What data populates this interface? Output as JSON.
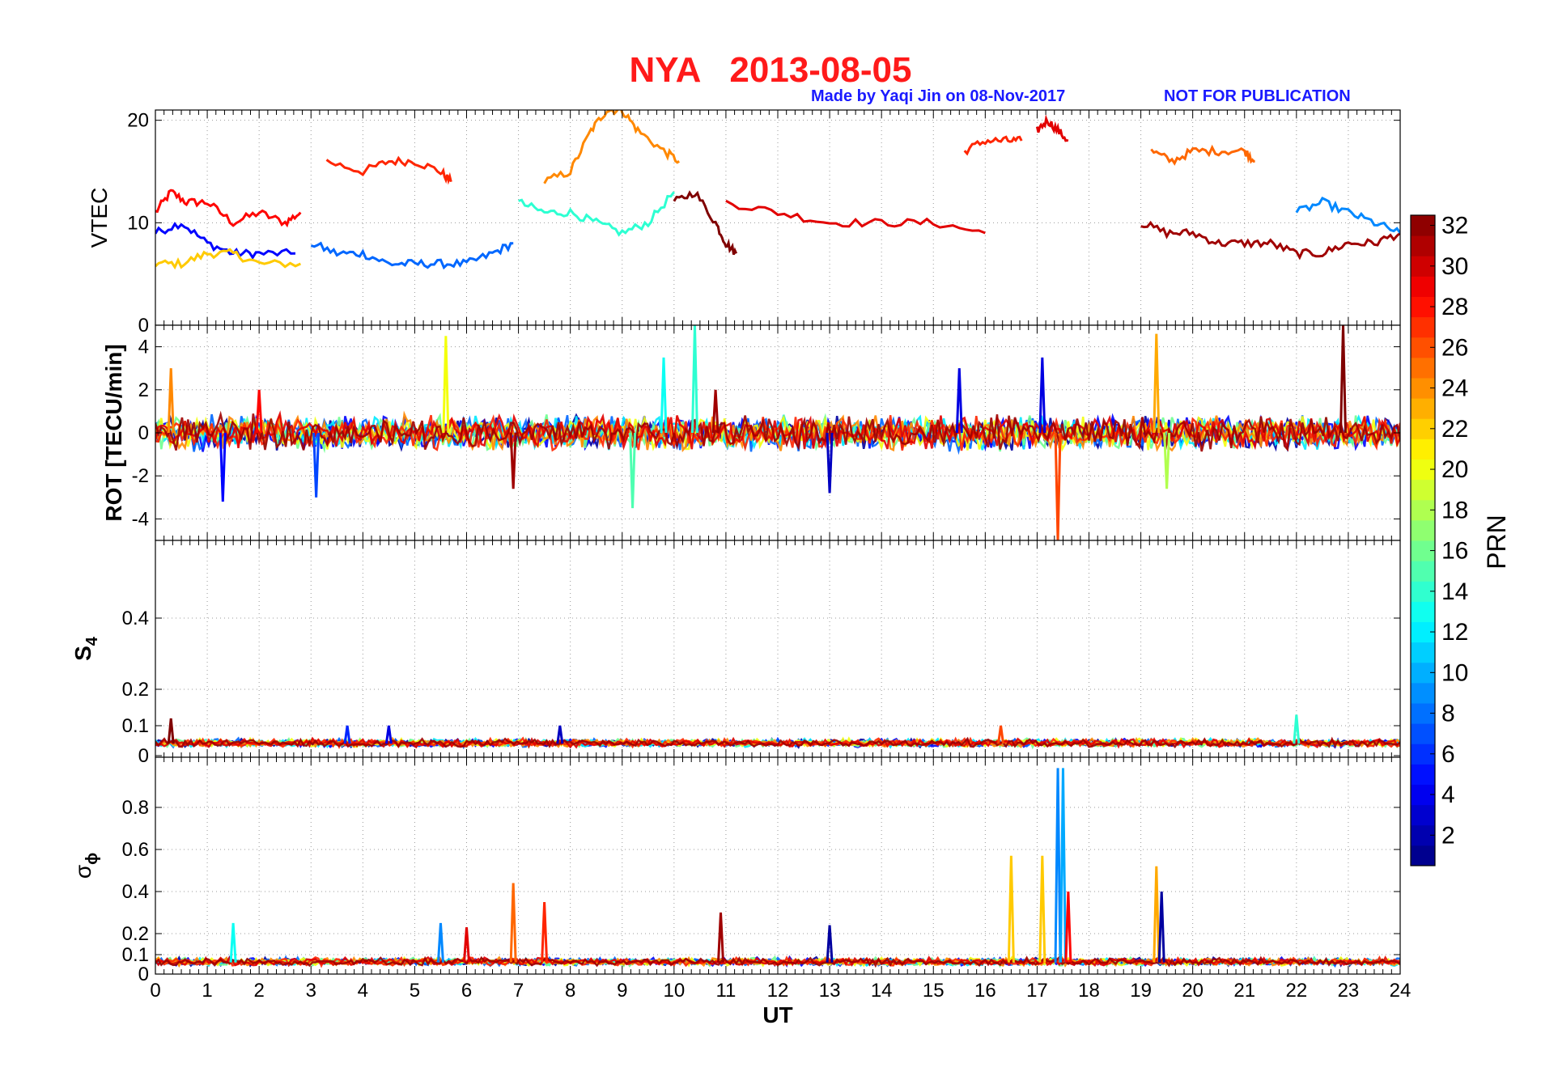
{
  "header": {
    "title": "NYA   2013-08-05",
    "credit": "Made by Yaqi Jin on 08-Nov-2017",
    "notice": "NOT FOR PUBLICATION"
  },
  "colors": {
    "title": "#ff1a1a",
    "credit": "#1a1aff",
    "axes": "#000000",
    "grid": "#9a9a9a"
  },
  "chart_data": [
    {
      "type": "line",
      "panel": "VTEC",
      "ylabel": "VTEC",
      "ylim": [
        0,
        21
      ],
      "yticks": [
        "0",
        "10",
        "20"
      ],
      "ytick_values": [
        0,
        10,
        20
      ],
      "xlim": [
        0,
        24
      ],
      "grid": true,
      "note_series": "multi-colored series, one per satellite PRN (1–32)",
      "series_approx": [
        {
          "prn": 28,
          "x": [
            0.0,
            0.3,
            0.6,
            1.0,
            1.5,
            2.0,
            2.5,
            2.8
          ],
          "y": [
            11,
            13,
            12,
            12,
            10,
            11,
            10,
            11
          ]
        },
        {
          "prn": 5,
          "x": [
            0.0,
            0.5,
            1.0,
            1.5,
            2.0,
            2.7
          ],
          "y": [
            9,
            10,
            8,
            7,
            7,
            7
          ]
        },
        {
          "prn": 22,
          "x": [
            0.0,
            0.5,
            1.0,
            1.5,
            2.0,
            2.8
          ],
          "y": [
            6,
            6,
            7,
            7,
            6,
            6
          ]
        },
        {
          "prn": 27,
          "x": [
            3.3,
            4.0,
            4.5,
            5.0,
            5.5,
            5.7
          ],
          "y": [
            16,
            15,
            16,
            16,
            15,
            14
          ]
        },
        {
          "prn": 8,
          "x": [
            3.0,
            3.5,
            4.0,
            4.5,
            5.0,
            5.5,
            6.0,
            6.5,
            6.9
          ],
          "y": [
            8,
            7,
            7,
            6,
            6,
            6,
            6,
            7,
            8
          ]
        },
        {
          "prn": 24,
          "x": [
            7.5,
            8.0,
            8.4,
            8.7,
            9.0,
            9.3,
            9.8,
            10.1
          ],
          "y": [
            14,
            15,
            19,
            21,
            21,
            19,
            17,
            16
          ]
        },
        {
          "prn": 14,
          "x": [
            7.0,
            7.5,
            8.0,
            8.5,
            9.0,
            9.5,
            10.0
          ],
          "y": [
            12,
            11,
            11,
            10,
            9,
            10,
            13
          ]
        },
        {
          "prn": 32,
          "x": [
            10.0,
            10.4,
            10.8,
            11.0,
            11.2
          ],
          "y": [
            12,
            13,
            10,
            8,
            7
          ]
        },
        {
          "prn": 29,
          "x": [
            11.0,
            12.0,
            13.0,
            14.0,
            15.0,
            16.0
          ],
          "y": [
            12,
            11,
            10,
            10,
            10,
            9
          ]
        },
        {
          "prn": 27,
          "x": [
            15.6,
            16.0,
            16.4,
            16.7
          ],
          "y": [
            17,
            18,
            18,
            18
          ]
        },
        {
          "prn": 29,
          "x": [
            17.0,
            17.2,
            17.4,
            17.6
          ],
          "y": [
            19,
            20,
            19,
            18
          ]
        },
        {
          "prn": 25,
          "x": [
            19.2,
            19.6,
            20.0,
            20.5,
            21.0,
            21.2
          ],
          "y": [
            17,
            16,
            17,
            17,
            17,
            16
          ]
        },
        {
          "prn": 31,
          "x": [
            19.0,
            19.5,
            20.0,
            20.5,
            21.0,
            21.5,
            22.0,
            22.5,
            23.0,
            23.5,
            24.0
          ],
          "y": [
            10,
            9,
            9,
            8,
            8,
            8,
            7,
            7,
            8,
            8,
            9
          ]
        },
        {
          "prn": 9,
          "x": [
            22.0,
            22.5,
            23.0,
            23.5,
            24.0
          ],
          "y": [
            11,
            12,
            11,
            10,
            9
          ]
        }
      ]
    },
    {
      "type": "line",
      "panel": "ROT",
      "ylabel": "ROT [TECU/min]",
      "ylim": [
        -5,
        5
      ],
      "yticks": [
        "-4",
        "-2",
        "0",
        "2",
        "4"
      ],
      "ytick_values": [
        -4,
        -2,
        0,
        2,
        4
      ],
      "xlim": [
        0,
        24
      ],
      "grid": true,
      "baseline": 0,
      "noise_amplitude": 0.6,
      "spikes": [
        {
          "x": 0.3,
          "y": 3.0,
          "prn": 24
        },
        {
          "x": 1.3,
          "y": -3.2,
          "prn": 5
        },
        {
          "x": 2.0,
          "y": 2.0,
          "prn": 28
        },
        {
          "x": 3.1,
          "y": -3.0,
          "prn": 7
        },
        {
          "x": 5.6,
          "y": 4.5,
          "prn": 20
        },
        {
          "x": 6.9,
          "y": -2.6,
          "prn": 31
        },
        {
          "x": 9.2,
          "y": -3.5,
          "prn": 15
        },
        {
          "x": 9.8,
          "y": 3.5,
          "prn": 13
        },
        {
          "x": 10.4,
          "y": 5.0,
          "prn": 14
        },
        {
          "x": 10.8,
          "y": 2.0,
          "prn": 31
        },
        {
          "x": 13.0,
          "y": -2.8,
          "prn": 3
        },
        {
          "x": 15.5,
          "y": 3.0,
          "prn": 4
        },
        {
          "x": 17.4,
          "y": -5.0,
          "prn": 26
        },
        {
          "x": 17.1,
          "y": 3.5,
          "prn": 4
        },
        {
          "x": 19.3,
          "y": 4.6,
          "prn": 23
        },
        {
          "x": 19.5,
          "y": -2.6,
          "prn": 18
        },
        {
          "x": 22.9,
          "y": 5.0,
          "prn": 32
        }
      ]
    },
    {
      "type": "line",
      "panel": "S4",
      "ylabel": "S4",
      "ylim": [
        0,
        0.6
      ],
      "yticks": [
        "0",
        "0.1",
        "0.2",
        "0.4"
      ],
      "ytick_values": [
        0,
        0.1,
        0.2,
        0.4
      ],
      "xlim": [
        0,
        24
      ],
      "grid": true,
      "baseline": 0.04,
      "noise_amplitude": 0.02,
      "spikes": [
        {
          "x": 0.3,
          "y": 0.12,
          "prn": 32
        },
        {
          "x": 3.7,
          "y": 0.1,
          "prn": 6
        },
        {
          "x": 4.5,
          "y": 0.1,
          "prn": 4
        },
        {
          "x": 7.8,
          "y": 0.1,
          "prn": 3
        },
        {
          "x": 16.3,
          "y": 0.1,
          "prn": 26
        },
        {
          "x": 22.0,
          "y": 0.13,
          "prn": 14
        }
      ]
    },
    {
      "type": "line",
      "panel": "sigma_phi",
      "ylabel": "σϕ",
      "ylim": [
        0,
        1.0
      ],
      "yticks": [
        "0",
        "0.1",
        "0.2",
        "0.4",
        "0.6",
        "0.8"
      ],
      "ytick_values": [
        0,
        0.1,
        0.2,
        0.4,
        0.6,
        0.8
      ],
      "xlim": [
        0,
        24
      ],
      "grid": true,
      "baseline": 0.06,
      "noise_amplitude": 0.03,
      "spikes": [
        {
          "x": 1.5,
          "y": 0.25,
          "prn": 13
        },
        {
          "x": 5.5,
          "y": 0.25,
          "prn": 9
        },
        {
          "x": 6.0,
          "y": 0.23,
          "prn": 29
        },
        {
          "x": 6.9,
          "y": 0.44,
          "prn": 25
        },
        {
          "x": 7.5,
          "y": 0.35,
          "prn": 27
        },
        {
          "x": 10.9,
          "y": 0.3,
          "prn": 31
        },
        {
          "x": 13.0,
          "y": 0.24,
          "prn": 2
        },
        {
          "x": 16.5,
          "y": 0.57,
          "prn": 22
        },
        {
          "x": 17.1,
          "y": 0.57,
          "prn": 22
        },
        {
          "x": 17.4,
          "y": 0.98,
          "prn": 9
        },
        {
          "x": 17.5,
          "y": 0.98,
          "prn": 10
        },
        {
          "x": 17.6,
          "y": 0.4,
          "prn": 28
        },
        {
          "x": 19.3,
          "y": 0.52,
          "prn": 23
        },
        {
          "x": 19.4,
          "y": 0.4,
          "prn": 2
        }
      ]
    }
  ],
  "xaxis": {
    "label": "UT",
    "ticks": [
      "0",
      "1",
      "2",
      "3",
      "4",
      "5",
      "6",
      "7",
      "8",
      "9",
      "10",
      "11",
      "12",
      "13",
      "14",
      "15",
      "16",
      "17",
      "18",
      "19",
      "20",
      "21",
      "22",
      "23",
      "24"
    ]
  },
  "colorbar": {
    "label": "PRN",
    "min": 1,
    "max": 32,
    "ticks": [
      "2",
      "4",
      "6",
      "8",
      "10",
      "12",
      "14",
      "16",
      "18",
      "20",
      "22",
      "24",
      "26",
      "28",
      "30",
      "32"
    ],
    "tick_values": [
      2,
      4,
      6,
      8,
      10,
      12,
      14,
      16,
      18,
      20,
      22,
      24,
      26,
      28,
      30,
      32
    ]
  }
}
